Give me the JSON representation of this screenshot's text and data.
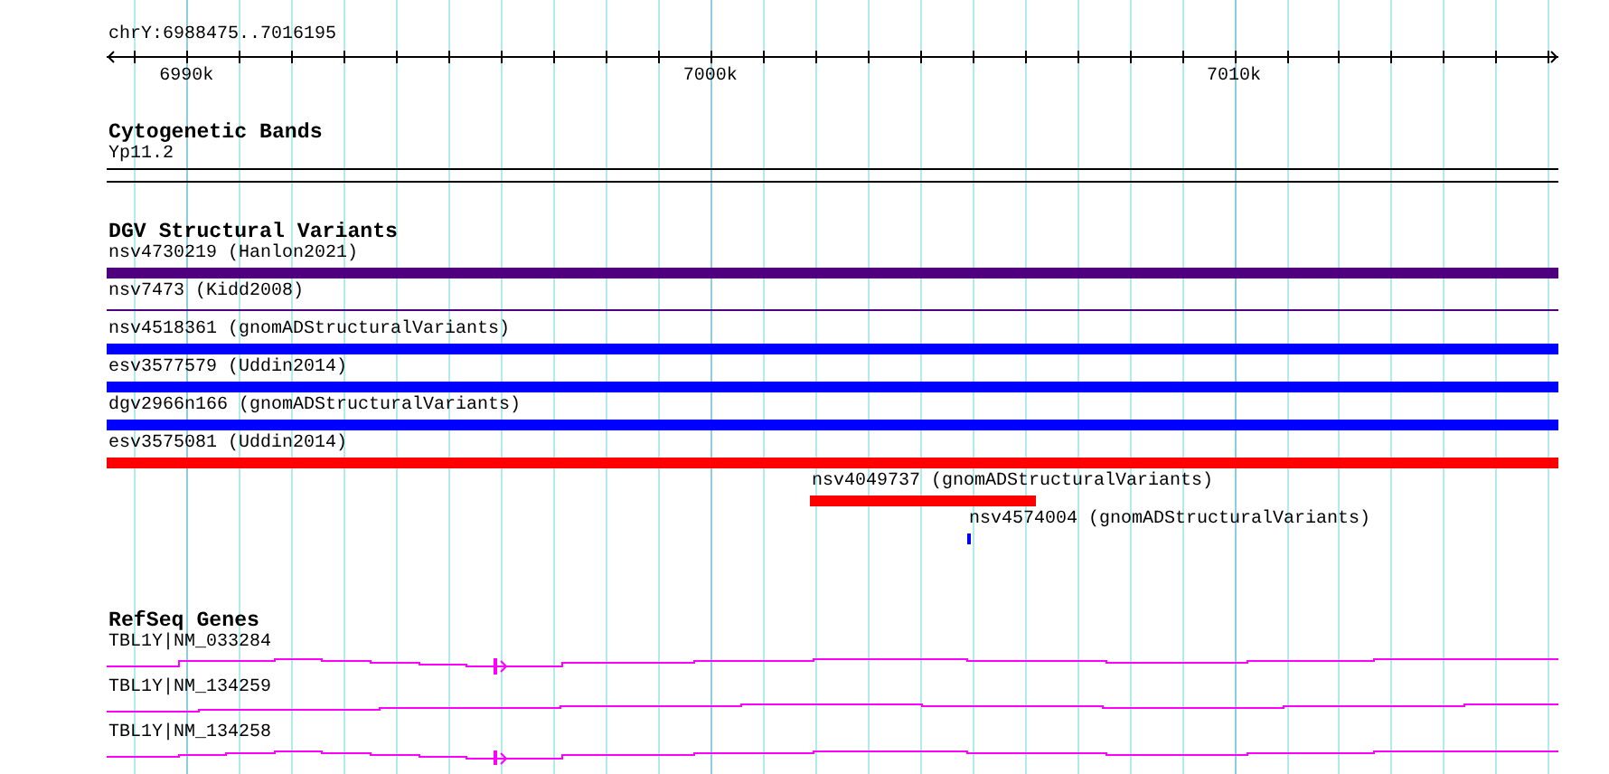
{
  "ruler": {
    "region": "chrY:6988475..7016195",
    "ticks": [
      {
        "label": "6990k"
      },
      {
        "label": "7000k"
      },
      {
        "label": "7010k"
      }
    ]
  },
  "cytobands": {
    "title": "Cytogenetic Bands",
    "bands": [
      {
        "name": "Yp11.2"
      }
    ]
  },
  "dgv": {
    "title": "DGV Structural Variants",
    "variants": [
      {
        "label": "nsv4730219 (Hanlon2021)",
        "kind": "bar",
        "color": "#4f007f"
      },
      {
        "label": "nsv7473 (Kidd2008)",
        "kind": "line",
        "color": "#4f007f"
      },
      {
        "label": "nsv4518361 (gnomADStructuralVariants)",
        "kind": "bar",
        "color": "#0000ff"
      },
      {
        "label": "esv3577579 (Uddin2014)",
        "kind": "bar",
        "color": "#0000ff"
      },
      {
        "label": "dgv2966n166 (gnomADStructuralVariants)",
        "kind": "bar",
        "color": "#0000ff"
      },
      {
        "label": "esv3575081 (Uddin2014)",
        "kind": "bar",
        "color": "#ff0000"
      },
      {
        "label": "nsv4049737 (gnomADStructuralVariants)",
        "kind": "bar",
        "color": "#ff0000"
      },
      {
        "label": "nsv4574004 (gnomADStructuralVariants)",
        "kind": "bar",
        "color": "#0000ff"
      }
    ]
  },
  "refseq": {
    "title": "RefSeq Genes",
    "genes": [
      {
        "label": "TBL1Y|NM_033284"
      },
      {
        "label": "TBL1Y|NM_134259"
      },
      {
        "label": "TBL1Y|NM_134258"
      }
    ]
  }
}
